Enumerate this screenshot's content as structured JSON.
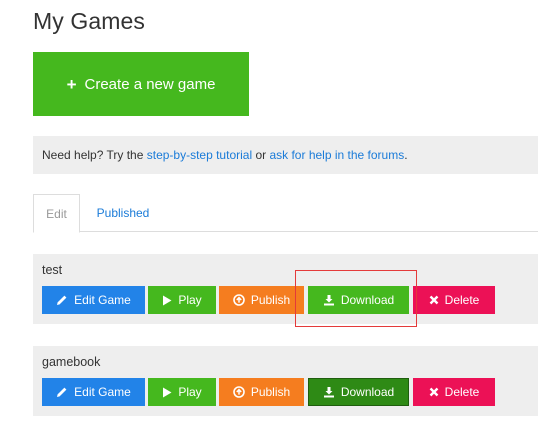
{
  "page": {
    "title": "My Games"
  },
  "create_button": {
    "label": "Create a new game",
    "icon": "plus-icon"
  },
  "help": {
    "prefix": "Need help? Try the ",
    "link1": "step-by-step tutorial",
    "middle": " or ",
    "link2": "ask for help in the forums",
    "suffix": "."
  },
  "tabs": [
    {
      "label": "Edit",
      "active": true
    },
    {
      "label": "Published",
      "active": false
    }
  ],
  "buttons": {
    "edit": "Edit Game",
    "play": "Play",
    "publish": "Publish",
    "download": "Download",
    "delete": "Delete"
  },
  "games": [
    {
      "title": "test"
    },
    {
      "title": "gamebook"
    }
  ],
  "colors": {
    "green": "#45b81e",
    "blue": "#2283e8",
    "orange": "#f57d1f",
    "red": "#ec1156",
    "link": "#1a7bd8",
    "highlight": "#e43a3a"
  }
}
